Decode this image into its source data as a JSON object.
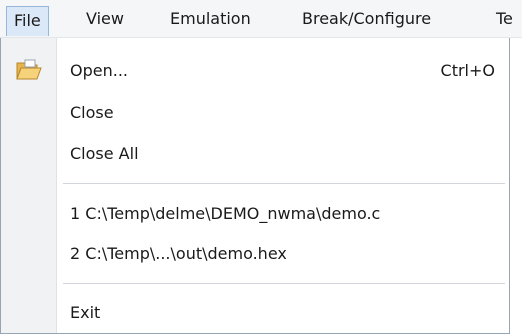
{
  "menubar": {
    "items": [
      {
        "label": "File"
      },
      {
        "label": "View"
      },
      {
        "label": "Emulation"
      },
      {
        "label": "Break/Configure"
      },
      {
        "label": "Te"
      }
    ]
  },
  "file_menu": {
    "open": {
      "label": "Open...",
      "shortcut": "Ctrl+O",
      "icon": "folder-open-icon"
    },
    "close": {
      "label": "Close"
    },
    "close_all": {
      "label": "Close All"
    },
    "recent": [
      {
        "label": "1 C:\\Temp\\delme\\DEMO_nwma\\demo.c"
      },
      {
        "label": "2 C:\\Temp\\...\\out\\demo.hex"
      }
    ],
    "exit": {
      "label": "Exit"
    }
  },
  "colors": {
    "active_menu_bg": "#dbe8f7",
    "active_menu_border": "#98b6dc",
    "menu_border": "#97a4b5"
  }
}
